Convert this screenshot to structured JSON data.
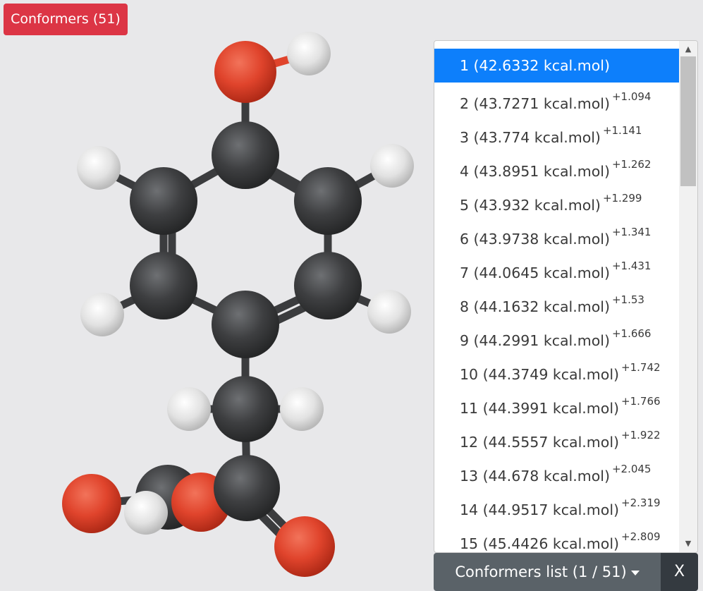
{
  "badge": {
    "label": "Conformers (51)"
  },
  "list": {
    "selected_index": 0,
    "items": [
      {
        "label": "1 (42.6332 kcal.mol)",
        "delta": ""
      },
      {
        "label": "2 (43.7271 kcal.mol)",
        "delta": "+1.094"
      },
      {
        "label": "3 (43.774 kcal.mol)",
        "delta": "+1.141"
      },
      {
        "label": "4 (43.8951 kcal.mol)",
        "delta": "+1.262"
      },
      {
        "label": "5 (43.932 kcal.mol)",
        "delta": "+1.299"
      },
      {
        "label": "6 (43.9738 kcal.mol)",
        "delta": "+1.341"
      },
      {
        "label": "7 (44.0645 kcal.mol)",
        "delta": "+1.431"
      },
      {
        "label": "8 (44.1632 kcal.mol)",
        "delta": "+1.53"
      },
      {
        "label": "9 (44.2991 kcal.mol)",
        "delta": "+1.666"
      },
      {
        "label": "10 (44.3749 kcal.mol)",
        "delta": "+1.742"
      },
      {
        "label": "11 (44.3991 kcal.mol)",
        "delta": "+1.766"
      },
      {
        "label": "12 (44.5557 kcal.mol)",
        "delta": "+1.922"
      },
      {
        "label": "13 (44.678 kcal.mol)",
        "delta": "+2.045"
      },
      {
        "label": "14 (44.9517 kcal.mol)",
        "delta": "+2.319"
      },
      {
        "label": "15 (45.4426 kcal.mol)",
        "delta": "+2.809"
      }
    ]
  },
  "toolbar": {
    "list_toggle_label": "Conformers list (1 / 51)",
    "close_label": "X"
  },
  "icons": {
    "scroll_up": "chevron-up-icon",
    "scroll_down": "chevron-down-icon",
    "dropdown": "caret-down-icon"
  },
  "colors": {
    "badge_bg": "#dc3545",
    "selected_bg": "#0d7ffb",
    "toggle_bg": "#5a6268",
    "close_bg": "#343a40",
    "carbon": "#3e3f41",
    "oxygen": "#e0442c",
    "hydrogen": "#e6e6e6"
  }
}
